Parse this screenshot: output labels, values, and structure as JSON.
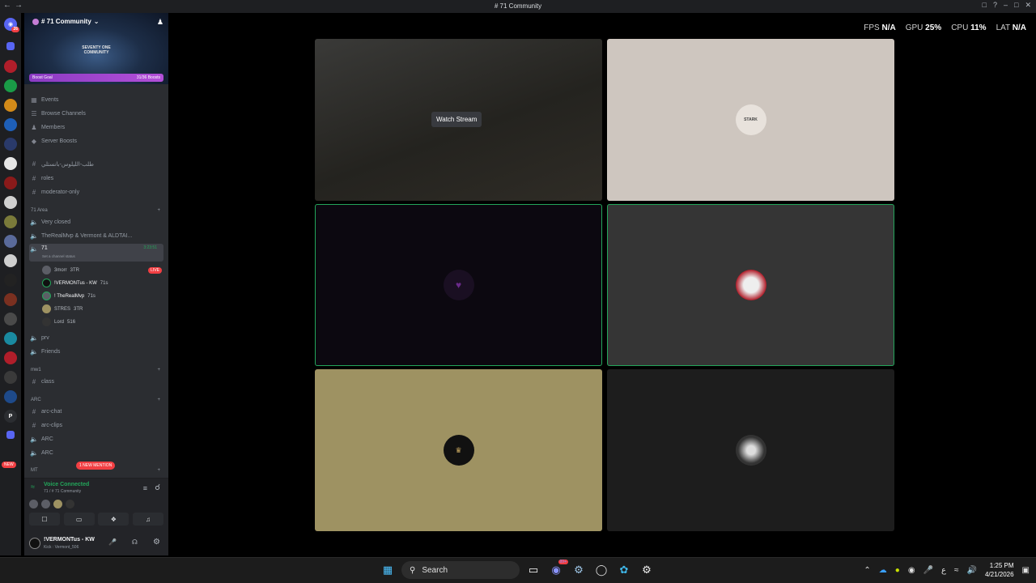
{
  "window": {
    "title": "# 71 Community"
  },
  "perf": {
    "fps_label": "FPS",
    "fps": "N/A",
    "gpu_label": "GPU",
    "gpu": "25%",
    "cpu_label": "CPU",
    "cpu": "11%",
    "lat_label": "LAT",
    "lat": "N/A"
  },
  "server": {
    "name": "# 71 Community",
    "banner_text_1": "SEVENTY ONE",
    "banner_text_2": "COMMUNITY",
    "boost_label": "Boost Goal",
    "boost_count": "31/36 Boosts"
  },
  "guild_badges": {
    "top": "26",
    "new": "NEW"
  },
  "menu": {
    "events": "Events",
    "browse": "Browse Channels",
    "members": "Members",
    "boosts": "Server Boosts"
  },
  "text_channels": [
    "طلب-الليلوس-بانستلي",
    "roles",
    "moderator-only"
  ],
  "category_71": "71 Area",
  "voice_channels": {
    "very_closed": "Very closed",
    "trio": "TheRealMvp & Vermont & ALDTAI...",
    "current": "71",
    "current_status": "Set a channel status",
    "current_timer": "3:23:51",
    "prv": "prv",
    "friends": "Friends"
  },
  "voice_users": [
    {
      "name": "3morr",
      "tag": "3TR",
      "live": "LIVE"
    },
    {
      "name": "!VERMONTus - KW",
      "tag": "71s"
    },
    {
      "name": "! TheRealMvp",
      "tag": "71s"
    },
    {
      "name": "STRES",
      "tag": "3TR"
    },
    {
      "name": "Lord",
      "tag": "516"
    }
  ],
  "category_mw1": "mw1",
  "mw1_channel": "class",
  "category_arc": "ARC",
  "arc_channels": [
    "arc-chat",
    "arc-clips",
    "ARC",
    "ARC"
  ],
  "category_mt": "MT",
  "mention_pill": "1 NEW MENTION",
  "voice_panel": {
    "title": "Voice Connected",
    "subtitle": "71 / # 71 Community"
  },
  "user": {
    "name": "!VERMONTus - KW",
    "status": "Kick : Vermont_506"
  },
  "stage": {
    "watch_stream": "Watch Stream",
    "tile_2_label": "STARK"
  },
  "taskbar": {
    "search_placeholder": "Search",
    "time": "1:25 PM",
    "date": "4/21/2026",
    "discord_badge": "99+"
  },
  "colors": {
    "sidebar": "#2b2d31",
    "speaking": "#23a55a",
    "live": "#f23f43",
    "tile_gold": "#9e9262",
    "tile_beige": "#cec6bf"
  }
}
